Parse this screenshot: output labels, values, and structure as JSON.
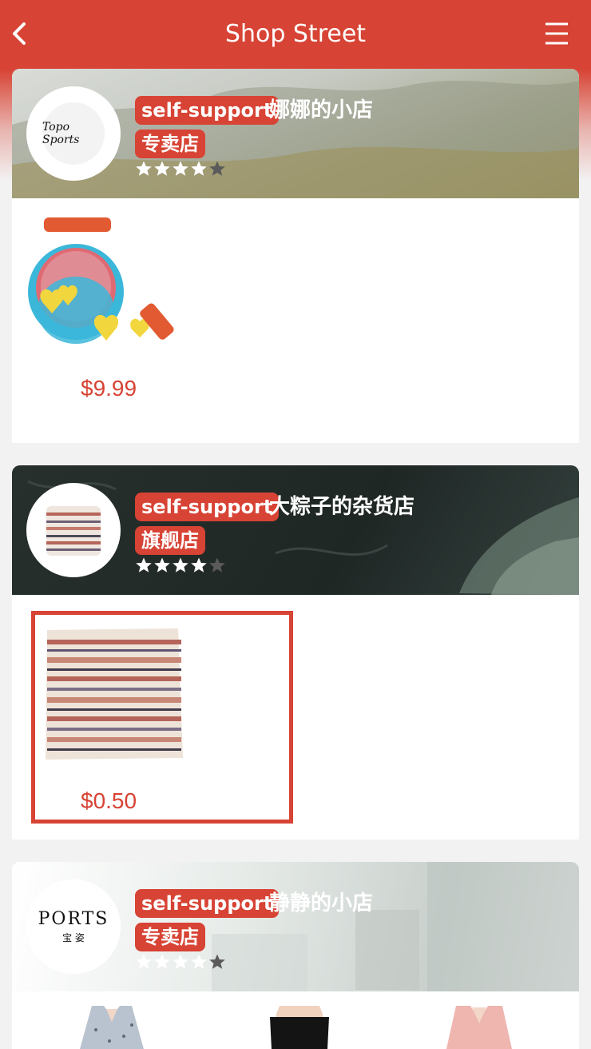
{
  "header": {
    "title": "Shop Street",
    "back_icon": "back-chevron-icon",
    "menu_icon": "hamburger-menu-icon"
  },
  "colors": {
    "accent": "#d74334",
    "price": "#d74334",
    "star_filled_white": "#ffffff",
    "star_filled_dark": "#5a5a5a"
  },
  "shops": [
    {
      "self_support_label": "self-support",
      "name": "娜娜的小店",
      "type_label": "专卖店",
      "logo_text": "Topo Sports",
      "rating": 4,
      "products": [
        {
          "image": "waffle-maker-toy",
          "price": "$9.99"
        }
      ]
    },
    {
      "self_support_label": "self-support",
      "name": "大粽子的杂货店",
      "type_label": "旗舰店",
      "logo_text": "",
      "rating": 4,
      "products": [
        {
          "image": "striped-cushion",
          "price": "$0.50",
          "selected": true
        }
      ]
    },
    {
      "self_support_label": "self-support",
      "name": "静静的小店",
      "type_label": "专卖店",
      "logo_text": "PORTS",
      "logo_subtext": "宝 姿",
      "rating": 4,
      "products": [
        {
          "image": "floral-wrap-dress"
        },
        {
          "image": "black-off-shoulder-dress"
        },
        {
          "image": "pink-wrap-dress"
        }
      ]
    }
  ]
}
